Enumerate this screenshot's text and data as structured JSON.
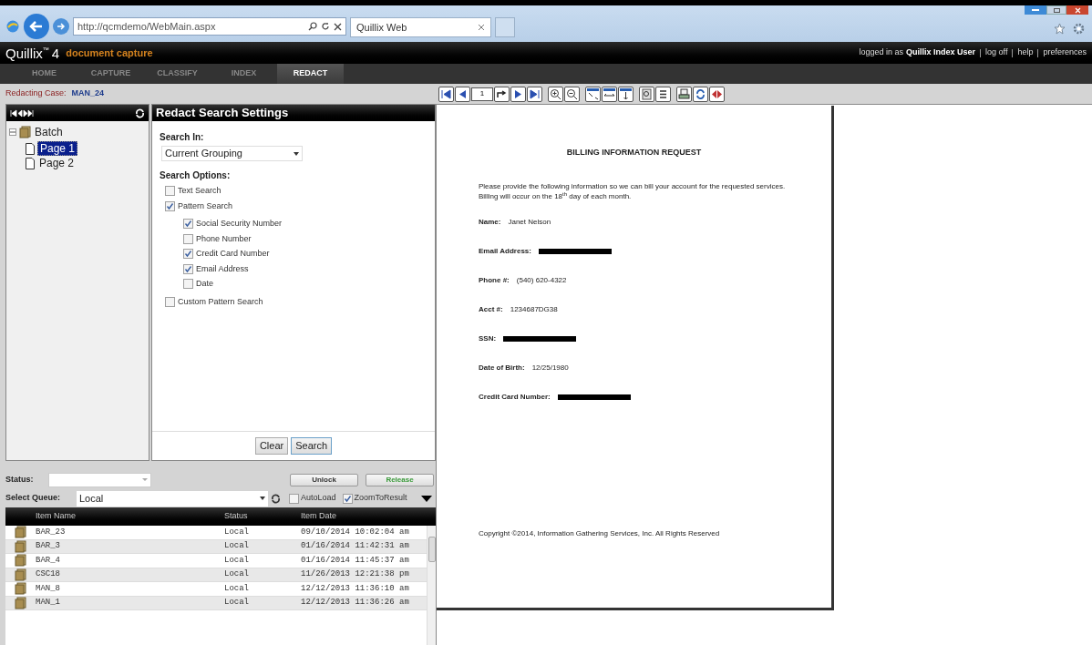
{
  "browser": {
    "url": "http://qcmdemo/WebMain.aspx",
    "tab_title": "Quillix Web"
  },
  "header": {
    "product": "Quillix",
    "trademark": "™",
    "version": "4",
    "subtitle": "document capture",
    "logged_in_label": "logged in as",
    "user": "Quillix Index User",
    "links": [
      "log off",
      "help",
      "preferences"
    ]
  },
  "nav_tabs": [
    {
      "label": "HOME",
      "selected": false
    },
    {
      "label": "CAPTURE",
      "selected": false
    },
    {
      "label": "CLASSIFY",
      "selected": false
    },
    {
      "label": "INDEX",
      "selected": false
    },
    {
      "label": "REDACT",
      "selected": true
    }
  ],
  "case": {
    "label": "Redacting Case:",
    "value": "MAN_24"
  },
  "tree": {
    "label": "Batch",
    "expanded": true,
    "children": [
      {
        "label": "Page 1",
        "selected": true
      },
      {
        "label": "Page 2",
        "selected": false
      }
    ]
  },
  "settings": {
    "title": "Redact Search Settings",
    "search_in_label": "Search In:",
    "search_in_value": "Current Grouping",
    "options_label": "Search Options:",
    "options": [
      {
        "label": "Text Search",
        "checked": false
      },
      {
        "label": "Pattern Search",
        "checked": true,
        "children": [
          {
            "label": "Social Security Number",
            "checked": true
          },
          {
            "label": "Phone Number",
            "checked": false
          },
          {
            "label": "Credit Card Number",
            "checked": true
          },
          {
            "label": "Email Address",
            "checked": true
          },
          {
            "label": "Date",
            "checked": false
          }
        ]
      },
      {
        "label": "Custom Pattern Search",
        "checked": false
      }
    ],
    "buttons": [
      "Clear",
      "Search"
    ]
  },
  "queue": {
    "status_label": "Status:",
    "unlock": "Unlock",
    "release": "Release",
    "select_label": "Select Queue:",
    "select_value": "Local",
    "autoload": {
      "label": "AutoLoad",
      "checked": false
    },
    "zoom_to_result": {
      "label": "ZoomToResult",
      "checked": true
    }
  },
  "table": {
    "columns": [
      "Item Name",
      "Status",
      "Item Date"
    ],
    "rows": [
      [
        "BAR_23",
        "Local",
        "09/10/2014 10:02:04 am"
      ],
      [
        "BAR_3",
        "Local",
        "01/16/2014 11:42:31 am"
      ],
      [
        "BAR_4",
        "Local",
        "01/16/2014 11:45:37 am"
      ],
      [
        "CSC18",
        "Local",
        "11/26/2013 12:21:38 pm"
      ],
      [
        "MAN_8",
        "Local",
        "12/12/2013 11:36:10 am"
      ],
      [
        "MAN_1",
        "Local",
        "12/12/2013 11:36:26 am"
      ]
    ]
  },
  "viewer": {
    "page": "1"
  },
  "document": {
    "title": "BILLING INFORMATION REQUEST",
    "intro": "Please provide the following information so we can bill your account for the requested services.  Billing will occur on the 18$^{th}$ day of each month.",
    "fields": [
      {
        "label": "Name:",
        "kind": "text",
        "value": "Janet Nelson"
      },
      {
        "label": "Email Address:",
        "kind": "redacted"
      },
      {
        "label": "Phone #:",
        "kind": "text",
        "value": "(540) 620-4322"
      },
      {
        "label": "Acct #:",
        "kind": "text",
        "value": "1234687DG38"
      },
      {
        "label": "SSN:",
        "kind": "redacted"
      },
      {
        "label": "Date of Birth:",
        "kind": "text",
        "value": "12/25/1980"
      },
      {
        "label": "Credit Card Number:",
        "kind": "redacted"
      }
    ],
    "copyright": "Copyright ©2014, Information Gathering Services, Inc. All Rights Reserved"
  }
}
